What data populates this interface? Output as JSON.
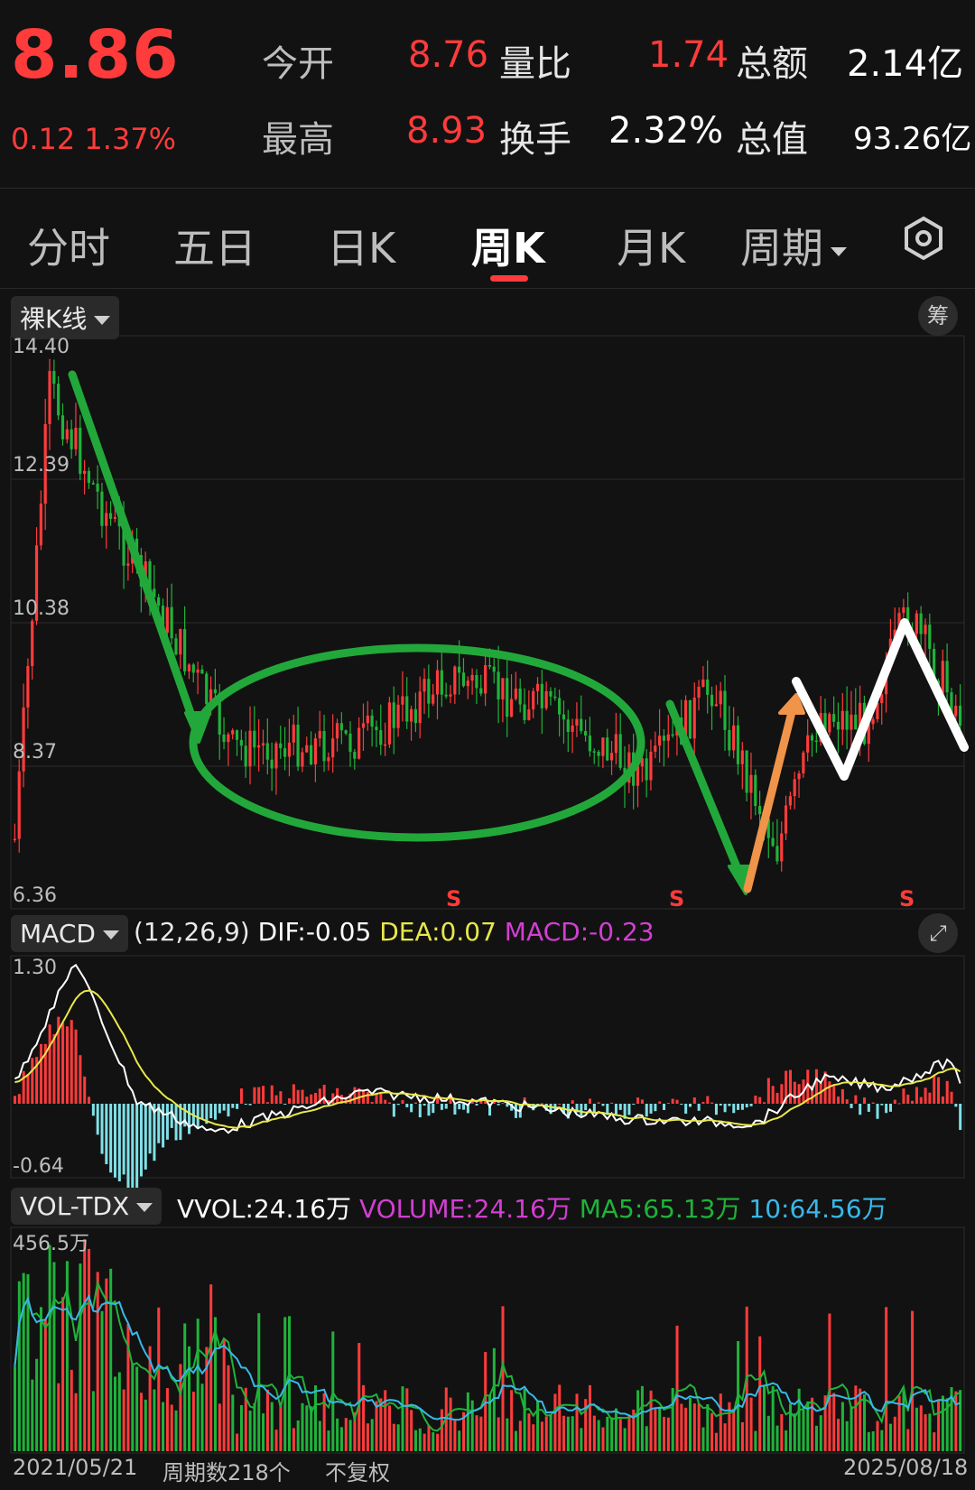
{
  "quote": {
    "price": "8.86",
    "change": "0.12",
    "change_pct": "1.37%",
    "open_label": "今开",
    "open_value": "8.76",
    "high_label": "最高",
    "high_value": "8.93",
    "vol_ratio_label": "量比",
    "vol_ratio_value": "1.74",
    "turnover_label": "换手",
    "turnover_value": "2.32%",
    "amount_label": "总额",
    "amount_value": "2.14亿",
    "mktcap_label": "总值",
    "mktcap_value": "93.26亿"
  },
  "tabs": [
    "分时",
    "五日",
    "日K",
    "周K",
    "月K",
    "周期"
  ],
  "active_tab": "周K",
  "toolbar": {
    "kline_type": "裸K线",
    "chip_button": "筹"
  },
  "price_axis": [
    "14.40",
    "12.39",
    "10.38",
    "8.37",
    "6.36"
  ],
  "signal_label": "S",
  "macd": {
    "name": "MACD",
    "params": "(12,26,9)",
    "dif_label": "DIF:",
    "dif_value": "-0.05",
    "dea_label": "DEA:",
    "dea_value": "0.07",
    "macd_label": "MACD:",
    "macd_value": "-0.23",
    "axis_top": "1.30",
    "axis_bottom": "-0.64"
  },
  "volume": {
    "name": "VOL-TDX",
    "vvol_label": "VVOL:",
    "vvol_value": "24.16万",
    "volume_label": "VOLUME:",
    "volume_value": "24.16万",
    "ma5_label": "MA5:",
    "ma5_value": "65.13万",
    "ma10_label": "10:",
    "ma10_value": "64.56万",
    "axis_top": "456.5万"
  },
  "footer": {
    "start_date": "2021/05/21",
    "period_count": "周期数218个",
    "adjust": "不复权",
    "end_date": "2025/08/18"
  },
  "colors": {
    "up": "#ff3b3b",
    "down": "#1fb33a",
    "macd_neg": "#7fe0e8",
    "dea": "#e8e84a",
    "macd_label": "#d23fd2",
    "ma10": "#39b8e8",
    "annotation_green": "#22a83a",
    "annotation_orange": "#f0944a",
    "annotation_white": "#ffffff"
  }
}
